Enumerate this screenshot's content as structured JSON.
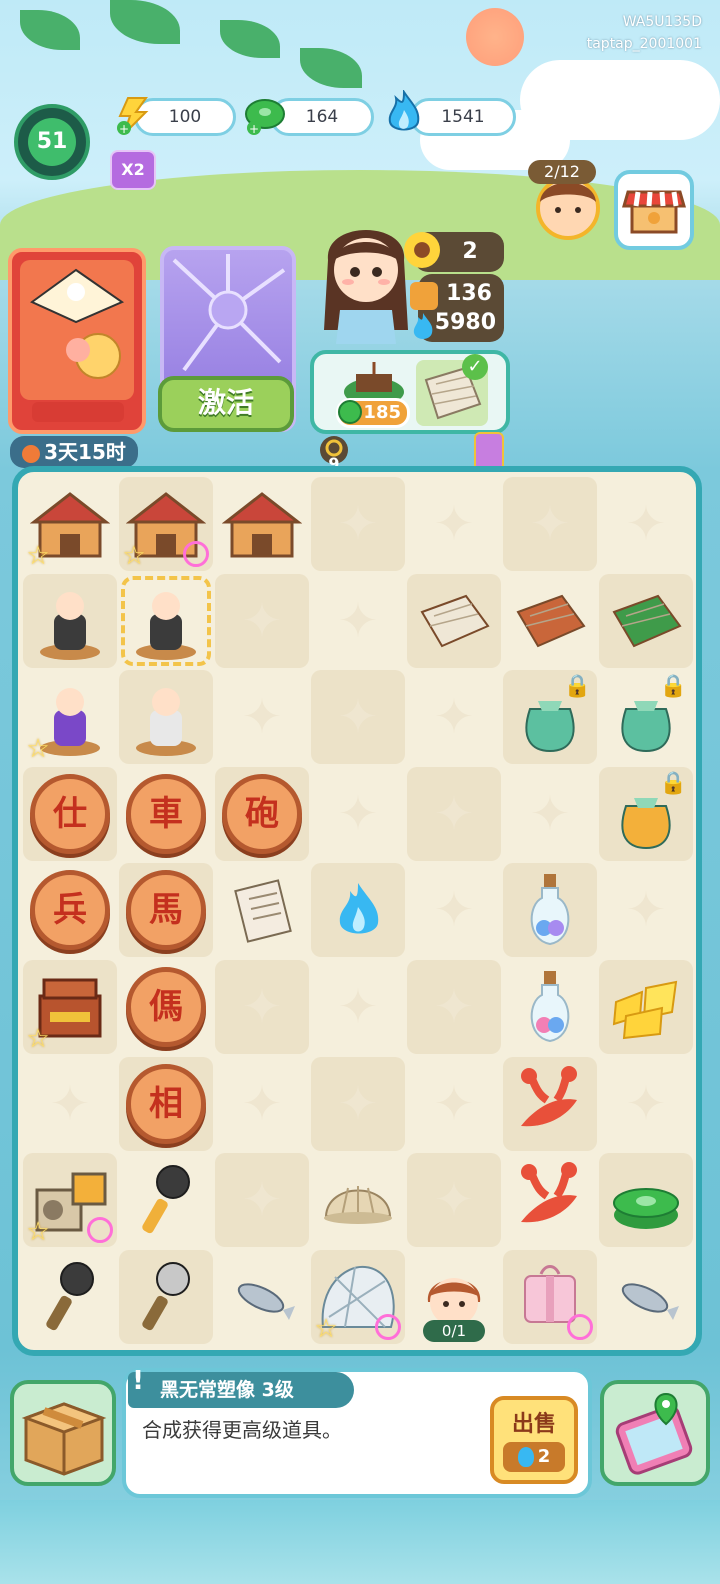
{
  "account": {
    "id_line1": "WA5U135D",
    "id_line2": "taptap_2001001"
  },
  "player": {
    "level": "51",
    "multiplier": "X2"
  },
  "resources": [
    {
      "name": "energy",
      "value": "100",
      "icon": "lightning-icon",
      "color": "#ffd43b"
    },
    {
      "name": "coins",
      "value": "164",
      "icon": "jade-coin-icon",
      "color": "#3dbb4d"
    },
    {
      "name": "flame",
      "value": "1541",
      "icon": "blue-flame-icon",
      "color": "#38b8f2"
    }
  ],
  "event": {
    "progress": "2/12",
    "timer": "3天15时",
    "activate_label": "激活",
    "bonus_count": "9"
  },
  "character": {
    "sunflowers": "2",
    "honey": "136",
    "flames": "5980"
  },
  "order": {
    "price": "185",
    "completed": true
  },
  "board": {
    "cols": 7,
    "rows": 9,
    "items": [
      {
        "r": 0,
        "c": 0,
        "kind": "building",
        "label": "temple",
        "star": true
      },
      {
        "r": 0,
        "c": 1,
        "kind": "building",
        "label": "market-stall",
        "star": true,
        "badge": true
      },
      {
        "r": 0,
        "c": 2,
        "kind": "building",
        "label": "wooden-shop"
      },
      {
        "r": 1,
        "c": 0,
        "kind": "statue",
        "label": "black-statue"
      },
      {
        "r": 1,
        "c": 1,
        "kind": "statue",
        "label": "black-wuchang-statue",
        "selected": true
      },
      {
        "r": 1,
        "c": 4,
        "kind": "board-game",
        "label": "go-board"
      },
      {
        "r": 1,
        "c": 5,
        "kind": "board-game",
        "label": "chess-table"
      },
      {
        "r": 1,
        "c": 6,
        "kind": "board-game",
        "label": "green-table"
      },
      {
        "r": 2,
        "c": 0,
        "kind": "statue",
        "label": "purple-hair-statue",
        "star": true
      },
      {
        "r": 2,
        "c": 1,
        "kind": "statue",
        "label": "white-wuchang-statue"
      },
      {
        "r": 2,
        "c": 5,
        "kind": "bag",
        "label": "green-bag",
        "locked": true
      },
      {
        "r": 2,
        "c": 6,
        "kind": "bag",
        "label": "teal-bag",
        "locked": true
      },
      {
        "r": 3,
        "c": 0,
        "kind": "chess",
        "text": "仕"
      },
      {
        "r": 3,
        "c": 1,
        "kind": "chess",
        "text": "車"
      },
      {
        "r": 3,
        "c": 2,
        "kind": "chess",
        "text": "砲"
      },
      {
        "r": 3,
        "c": 6,
        "kind": "bag",
        "label": "gold-bag",
        "locked": true
      },
      {
        "r": 4,
        "c": 0,
        "kind": "chess",
        "text": "兵"
      },
      {
        "r": 4,
        "c": 1,
        "kind": "chess",
        "text": "馬"
      },
      {
        "r": 4,
        "c": 2,
        "kind": "scroll",
        "label": "paper-scroll"
      },
      {
        "r": 4,
        "c": 3,
        "kind": "flame",
        "label": "blue-flame"
      },
      {
        "r": 4,
        "c": 5,
        "kind": "bottle",
        "label": "bottle-blue"
      },
      {
        "r": 5,
        "c": 0,
        "kind": "chest",
        "label": "treasure-chest",
        "star": true
      },
      {
        "r": 5,
        "c": 1,
        "kind": "chess",
        "text": "傌"
      },
      {
        "r": 5,
        "c": 5,
        "kind": "bottle",
        "label": "bottle-pink"
      },
      {
        "r": 5,
        "c": 6,
        "kind": "energy",
        "label": "energy-bolts"
      },
      {
        "r": 6,
        "c": 1,
        "kind": "chess",
        "text": "相"
      },
      {
        "r": 6,
        "c": 5,
        "kind": "lobster",
        "label": "crayfish"
      },
      {
        "r": 7,
        "c": 0,
        "kind": "radio",
        "label": "radio-set",
        "star": true,
        "badge": true
      },
      {
        "r": 7,
        "c": 1,
        "kind": "mic",
        "label": "microphone-gold"
      },
      {
        "r": 7,
        "c": 3,
        "kind": "shell",
        "label": "clam-shell"
      },
      {
        "r": 7,
        "c": 5,
        "kind": "lobster",
        "label": "crayfish"
      },
      {
        "r": 7,
        "c": 6,
        "kind": "coins",
        "label": "jade-coins"
      },
      {
        "r": 8,
        "c": 0,
        "kind": "mic",
        "label": "microphone-dark"
      },
      {
        "r": 8,
        "c": 1,
        "kind": "mic",
        "label": "microphone-silver"
      },
      {
        "r": 8,
        "c": 2,
        "kind": "fish",
        "label": "small-fish"
      },
      {
        "r": 8,
        "c": 3,
        "kind": "net",
        "label": "fishing-net",
        "star": true,
        "badge": true
      },
      {
        "r": 8,
        "c": 4,
        "kind": "npc",
        "label": "girl-helper",
        "counter": "0/1"
      },
      {
        "r": 8,
        "c": 5,
        "kind": "gift",
        "label": "pink-gift",
        "badge": true
      },
      {
        "r": 8,
        "c": 6,
        "kind": "fish",
        "label": "small-fish"
      }
    ]
  },
  "info_panel": {
    "item_name": "黑无常塑像 3级",
    "description": "合成获得更高级道具。",
    "sell_label": "出售",
    "sell_price": "2"
  }
}
